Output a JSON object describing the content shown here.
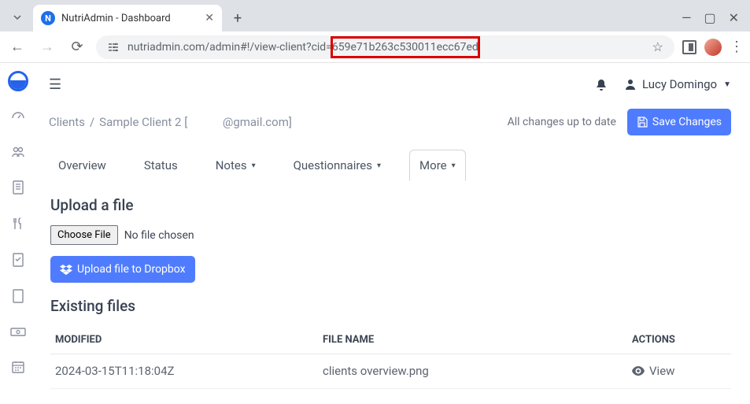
{
  "browser": {
    "tab_title": "NutriAdmin - Dashboard",
    "url_prefix": "nutriadmin.com/admin#!/view-client?cid=",
    "url_highlighted": "659e71b263c530011ecc67ed"
  },
  "topbar": {
    "user_name": "Lucy Domingo"
  },
  "breadcrumb": {
    "root": "Clients",
    "current_prefix": "Sample Client 2 [",
    "current_suffix": "@gmail.com]",
    "redacted": "            "
  },
  "save": {
    "status": "All changes up to date",
    "button": "Save Changes"
  },
  "tabs": {
    "overview": "Overview",
    "status": "Status",
    "notes": "Notes",
    "questionnaires": "Questionnaires",
    "more": "More"
  },
  "upload": {
    "heading": "Upload a file",
    "choose": "Choose File",
    "no_file": "No file chosen",
    "dropbox_btn": "Upload file to Dropbox"
  },
  "files": {
    "heading": "Existing files",
    "headers": {
      "modified": "MODIFIED",
      "filename": "FILE NAME",
      "actions": "ACTIONS"
    },
    "rows": [
      {
        "modified": "2024-03-15T11:18:04Z",
        "filename": "clients overview.png",
        "action": "View"
      }
    ]
  }
}
